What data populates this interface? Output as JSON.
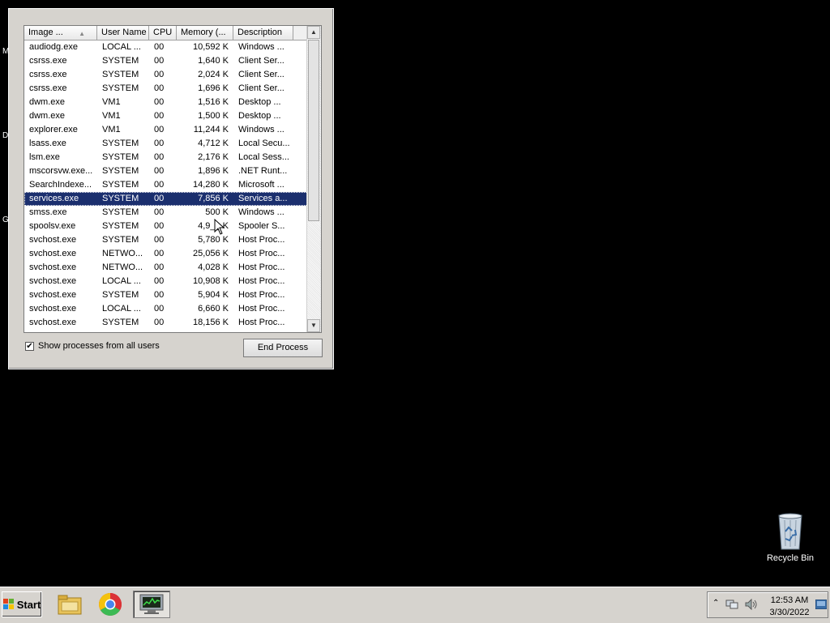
{
  "desktop": {
    "edge_letters": [
      "M",
      "D",
      "G"
    ],
    "recycle_bin_label": "Recycle Bin"
  },
  "task_manager": {
    "columns": [
      {
        "key": "image",
        "label": "Image ...",
        "sorted": true
      },
      {
        "key": "user",
        "label": "User Name"
      },
      {
        "key": "cpu",
        "label": "CPU"
      },
      {
        "key": "memory",
        "label": "Memory (..."
      },
      {
        "key": "description",
        "label": "Description"
      }
    ],
    "processes": [
      {
        "image": "audiodg.exe",
        "user": "LOCAL ...",
        "cpu": "00",
        "memory": "10,592 K",
        "description": "Windows ..."
      },
      {
        "image": "csrss.exe",
        "user": "SYSTEM",
        "cpu": "00",
        "memory": "1,640 K",
        "description": "Client Ser..."
      },
      {
        "image": "csrss.exe",
        "user": "SYSTEM",
        "cpu": "00",
        "memory": "2,024 K",
        "description": "Client Ser..."
      },
      {
        "image": "csrss.exe",
        "user": "SYSTEM",
        "cpu": "00",
        "memory": "1,696 K",
        "description": "Client Ser..."
      },
      {
        "image": "dwm.exe",
        "user": "VM1",
        "cpu": "00",
        "memory": "1,516 K",
        "description": "Desktop ..."
      },
      {
        "image": "dwm.exe",
        "user": "VM1",
        "cpu": "00",
        "memory": "1,500 K",
        "description": "Desktop ..."
      },
      {
        "image": "explorer.exe",
        "user": "VM1",
        "cpu": "00",
        "memory": "11,244 K",
        "description": "Windows ..."
      },
      {
        "image": "lsass.exe",
        "user": "SYSTEM",
        "cpu": "00",
        "memory": "4,712 K",
        "description": "Local Secu..."
      },
      {
        "image": "lsm.exe",
        "user": "SYSTEM",
        "cpu": "00",
        "memory": "2,176 K",
        "description": "Local Sess..."
      },
      {
        "image": "mscorsvw.exe...",
        "user": "SYSTEM",
        "cpu": "00",
        "memory": "1,896 K",
        "description": ".NET Runt..."
      },
      {
        "image": "SearchIndexe...",
        "user": "SYSTEM",
        "cpu": "00",
        "memory": "14,280 K",
        "description": "Microsoft ..."
      },
      {
        "image": "services.exe",
        "user": "SYSTEM",
        "cpu": "00",
        "memory": "7,856 K",
        "description": "Services a...",
        "selected": true
      },
      {
        "image": "smss.exe",
        "user": "SYSTEM",
        "cpu": "00",
        "memory": "500 K",
        "description": "Windows ..."
      },
      {
        "image": "spoolsv.exe",
        "user": "SYSTEM",
        "cpu": "00",
        "memory": "4,9__ K",
        "description": "Spooler S..."
      },
      {
        "image": "svchost.exe",
        "user": "SYSTEM",
        "cpu": "00",
        "memory": "5,780 K",
        "description": "Host Proc..."
      },
      {
        "image": "svchost.exe",
        "user": "NETWO...",
        "cpu": "00",
        "memory": "25,056 K",
        "description": "Host Proc..."
      },
      {
        "image": "svchost.exe",
        "user": "NETWO...",
        "cpu": "00",
        "memory": "4,028 K",
        "description": "Host Proc..."
      },
      {
        "image": "svchost.exe",
        "user": "LOCAL ...",
        "cpu": "00",
        "memory": "10,908 K",
        "description": "Host Proc..."
      },
      {
        "image": "svchost.exe",
        "user": "SYSTEM",
        "cpu": "00",
        "memory": "5,904 K",
        "description": "Host Proc..."
      },
      {
        "image": "svchost.exe",
        "user": "LOCAL ...",
        "cpu": "00",
        "memory": "6,660 K",
        "description": "Host Proc..."
      },
      {
        "image": "svchost.exe",
        "user": "SYSTEM",
        "cpu": "00",
        "memory": "18,156 K",
        "description": "Host Proc..."
      }
    ],
    "show_all_users_label": "Show processes from all users",
    "show_all_users_checked": true,
    "end_process_label": "End Process"
  },
  "taskbar": {
    "start_label": "Start",
    "apps": [
      {
        "name": "windows-explorer-icon"
      },
      {
        "name": "chrome-icon"
      },
      {
        "name": "task-manager-icon",
        "active": true
      }
    ],
    "tray": {
      "time": "12:53 AM",
      "date": "3/30/2022"
    }
  }
}
